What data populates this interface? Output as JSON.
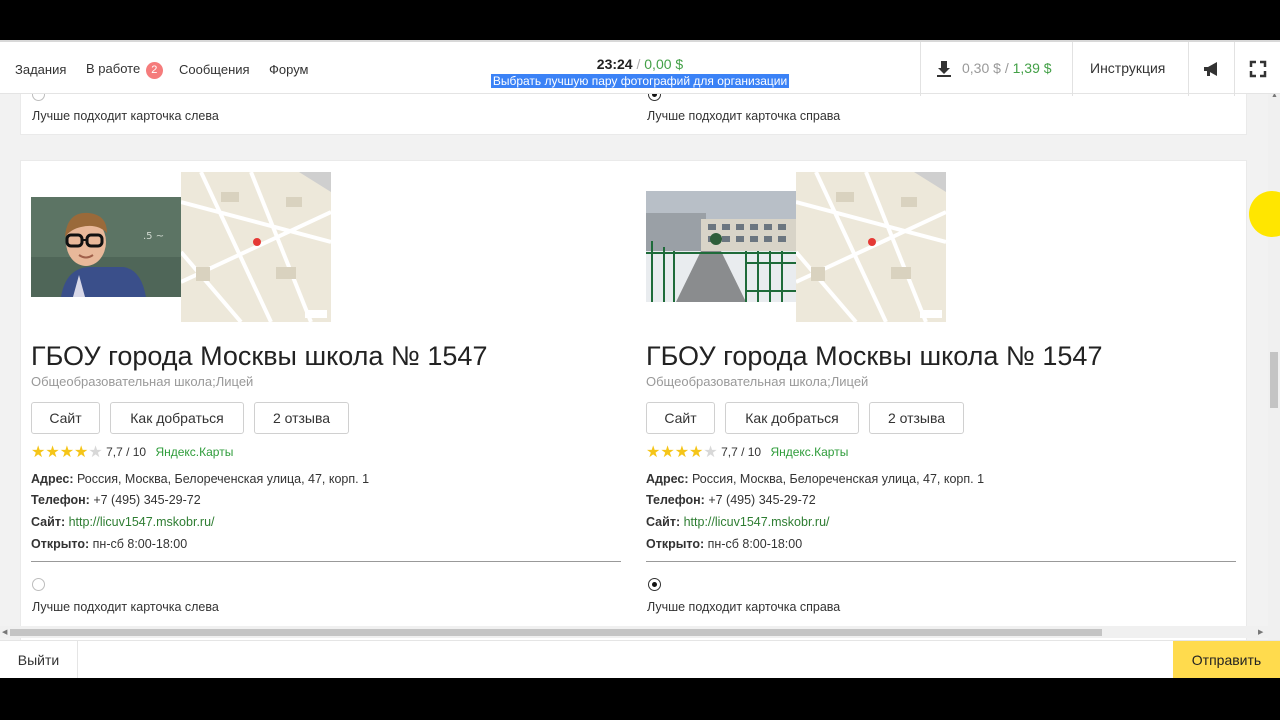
{
  "header": {
    "nav": [
      {
        "label": "Задания"
      },
      {
        "label": "В работе",
        "badge": "2"
      },
      {
        "label": "Сообщения"
      },
      {
        "label": "Форум"
      }
    ],
    "timer": "23:24",
    "timer_sep": "/",
    "session_earned": "0,00 $",
    "task_title": "Выбрать лучшую пару фотографий для организации",
    "balance": "0,30 $",
    "balance_sep": "/",
    "balance_total": "1,39 $",
    "instructions_label": "Инструкция",
    "icons": [
      "download-icon",
      "megaphone-icon",
      "fullscreen-icon"
    ]
  },
  "previous_task": {
    "left_label": "Лучше подходит карточка слева",
    "right_label": "Лучше подходит карточка справа",
    "selected": "right"
  },
  "cards": [
    {
      "photo": "boy-with-glasses-photo",
      "title": "ГБОУ города Москвы школа № 1547",
      "category": "Общеобразовательная школа;Лицей",
      "buttons": [
        "Сайт",
        "Как добраться",
        "2 отзыва"
      ],
      "stars": 4,
      "rating": "7,7",
      "rating_max": "/ 10",
      "source": "Яндекс.Карты",
      "address_label": "Адрес:",
      "address": "Россия, Москва, Белореченская улица, 47, корп. 1",
      "phone_label": "Телефон:",
      "phone": "+7 (495) 345-29-72",
      "site_label": "Сайт:",
      "site": "http://licuv1547.mskobr.ru/",
      "hours_label": "Открыто:",
      "hours": "пн-сб 8:00-18:00"
    },
    {
      "photo": "school-building-photo",
      "title": "ГБОУ города Москвы школа № 1547",
      "category": "Общеобразовательная школа;Лицей",
      "buttons": [
        "Сайт",
        "Как добраться",
        "2 отзыва"
      ],
      "stars": 4,
      "rating": "7,7",
      "rating_max": "/ 10",
      "source": "Яндекс.Карты",
      "address_label": "Адрес:",
      "address": "Россия, Москва, Белореченская улица, 47, корп. 1",
      "phone_label": "Телефон:",
      "phone": "+7 (495) 345-29-72",
      "site_label": "Сайт:",
      "site": "http://licuv1547.mskobr.ru/",
      "hours_label": "Открыто:",
      "hours": "пн-сб 8:00-18:00"
    }
  ],
  "current_task": {
    "left_label": "Лучше подходит карточка слева",
    "right_label": "Лучше подходит карточка справа",
    "selected": "right"
  },
  "footer": {
    "exit_label": "Выйти",
    "submit_label": "Отправить"
  },
  "colors": {
    "accent_yellow": "#ffdb4d",
    "money_green": "#43a047",
    "link_green": "#2e7d32",
    "badge_red": "#f57c7c",
    "highlight_blue": "#3b82f6",
    "star_gold": "#f5c518"
  }
}
